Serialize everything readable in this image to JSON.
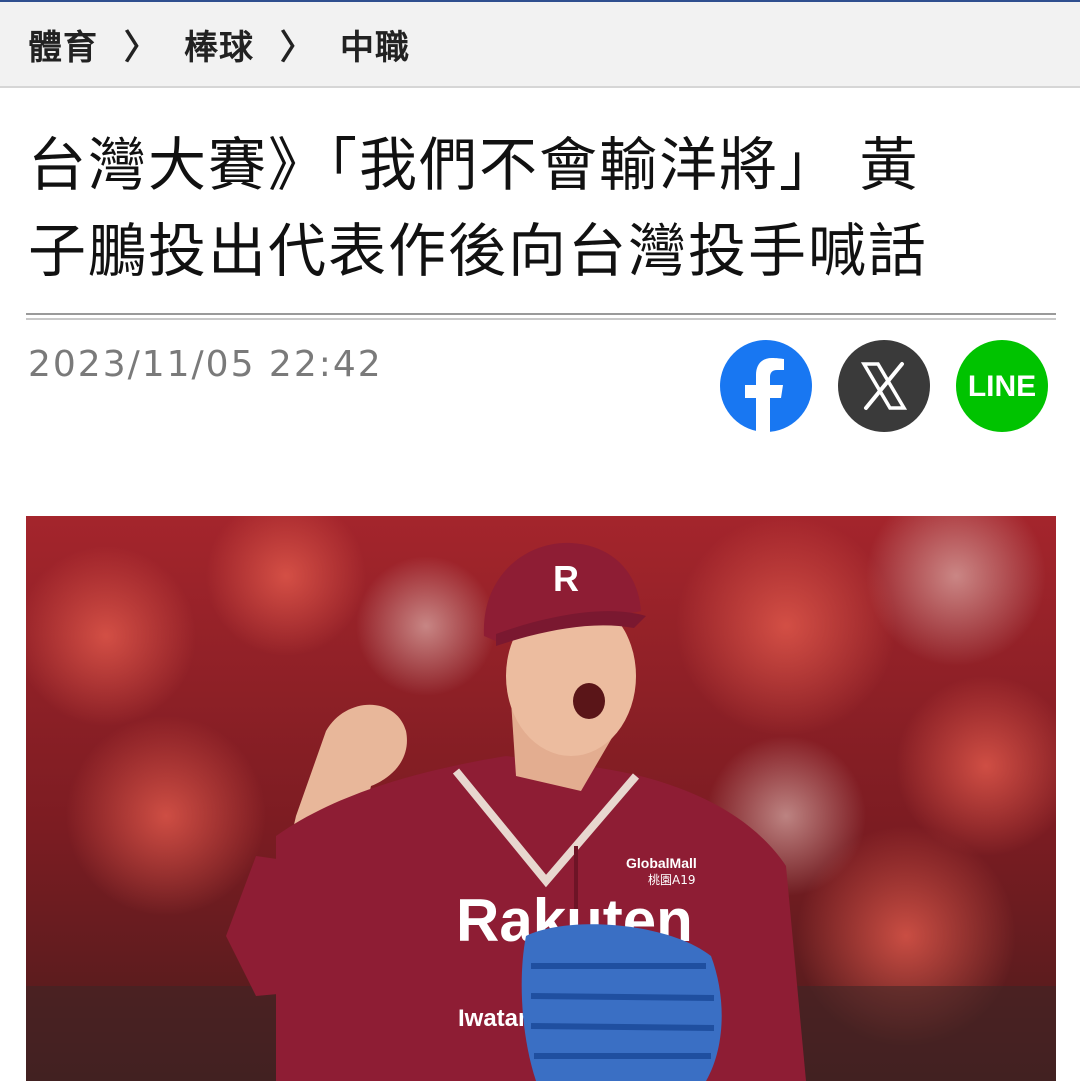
{
  "breadcrumb": {
    "items": [
      "體育",
      "棒球",
      "中職"
    ],
    "separator": "〉"
  },
  "article": {
    "title_line1": "台灣大賽》「我們不會輸洋將」 黃",
    "title_line2": "子鵬投出代表作後向台灣投手喊話",
    "timestamp": "2023/11/05 22:42"
  },
  "share": {
    "facebook_icon": "facebook-icon",
    "x_icon": "x-icon",
    "line_label": "LINE",
    "colors": {
      "facebook": "#1877f2",
      "x": "#3a3a3a",
      "line": "#00c300"
    }
  },
  "photo": {
    "cap_letter": "R",
    "jersey_brand": "Rakuten",
    "sleeve_sponsor": "Iwatani",
    "chest_sponsor_line1": "GlobalMall",
    "chest_sponsor_line2": "桃園A19",
    "colors": {
      "jersey": "#8e1d34",
      "crowd": "#b2262c",
      "glove": "#3a6fc4"
    }
  }
}
